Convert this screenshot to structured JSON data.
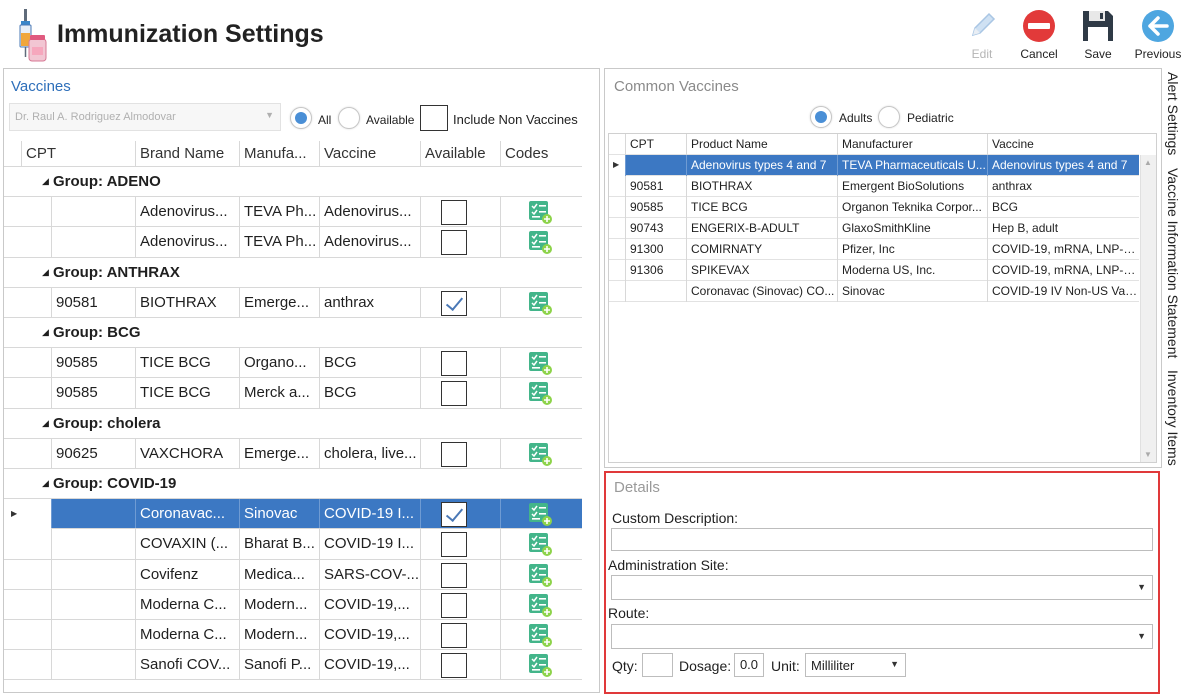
{
  "header": {
    "title": "Immunization Settings",
    "toolbar": {
      "edit": "Edit",
      "cancel": "Cancel",
      "save": "Save",
      "previous": "Previous"
    }
  },
  "vaccines": {
    "title": "Vaccines",
    "provider": "Dr. Raul A. Rodriguez Almodovar",
    "filter_all": "All",
    "filter_available": "Available",
    "include_non_vaccines": "Include Non Vaccines",
    "columns": [
      "CPT",
      "Brand Name",
      "Manufa...",
      "Vaccine",
      "Available",
      "Codes"
    ],
    "groups": [
      {
        "label": "Group: ADENO"
      },
      {
        "label": "Group: ANTHRAX"
      },
      {
        "label": "Group: BCG"
      },
      {
        "label": "Group: cholera"
      },
      {
        "label": "Group: COVID-19"
      }
    ],
    "rows": [
      {
        "cpt": "",
        "brand": "Adenovirus...",
        "manufacturer": "TEVA Ph...",
        "vaccine": "Adenovirus...",
        "available": false
      },
      {
        "cpt": "",
        "brand": "Adenovirus...",
        "manufacturer": "TEVA Ph...",
        "vaccine": "Adenovirus...",
        "available": false
      },
      {
        "cpt": "90581",
        "brand": "BIOTHRAX",
        "manufacturer": "Emerge...",
        "vaccine": "anthrax",
        "available": true
      },
      {
        "cpt": "90585",
        "brand": "TICE BCG",
        "manufacturer": "Organo...",
        "vaccine": "BCG",
        "available": false
      },
      {
        "cpt": "90585",
        "brand": "TICE BCG",
        "manufacturer": "Merck a...",
        "vaccine": "BCG",
        "available": false
      },
      {
        "cpt": "90625",
        "brand": "VAXCHORA",
        "manufacturer": "Emerge...",
        "vaccine": "cholera, live...",
        "available": false
      },
      {
        "cpt": "",
        "brand": "Coronavac...",
        "manufacturer": "Sinovac",
        "vaccine": "COVID-19 I...",
        "available": true
      },
      {
        "cpt": "",
        "brand": "COVAXIN (...",
        "manufacturer": "Bharat B...",
        "vaccine": "COVID-19 I...",
        "available": false
      },
      {
        "cpt": "",
        "brand": "Covifenz",
        "manufacturer": "Medica...",
        "vaccine": "SARS-COV-...",
        "available": false
      },
      {
        "cpt": "",
        "brand": "Moderna C...",
        "manufacturer": "Modern...",
        "vaccine": "COVID-19,...",
        "available": false
      },
      {
        "cpt": "",
        "brand": "Moderna C...",
        "manufacturer": "Modern...",
        "vaccine": "COVID-19,...",
        "available": false
      },
      {
        "cpt": "",
        "brand": "Sanofi COV...",
        "manufacturer": "Sanofi P...",
        "vaccine": "COVID-19,...",
        "available": false
      }
    ]
  },
  "common": {
    "title": "Common Vaccines",
    "adults": "Adults",
    "pediatric": "Pediatric",
    "columns": [
      "CPT",
      "Product Name",
      "Manufacturer",
      "Vaccine"
    ],
    "rows": [
      {
        "cpt": "",
        "product": "Adenovirus types 4 and 7",
        "manufacturer": "TEVA Pharmaceuticals U...",
        "vaccine": "Adenovirus types 4 and 7"
      },
      {
        "cpt": "90581",
        "product": "BIOTHRAX",
        "manufacturer": "Emergent BioSolutions",
        "vaccine": "anthrax"
      },
      {
        "cpt": "90585",
        "product": "TICE BCG",
        "manufacturer": "Organon Teknika Corpor...",
        "vaccine": "BCG"
      },
      {
        "cpt": "90743",
        "product": "ENGERIX-B-ADULT",
        "manufacturer": "GlaxoSmithKline",
        "vaccine": "Hep B, adult"
      },
      {
        "cpt": "91300",
        "product": "COMIRNATY",
        "manufacturer": "Pfizer, Inc",
        "vaccine": "COVID-19, mRNA, LNP-S,..."
      },
      {
        "cpt": "91306",
        "product": "SPIKEVAX",
        "manufacturer": "Moderna US, Inc.",
        "vaccine": "COVID-19, mRNA, LNP-S,..."
      },
      {
        "cpt": "",
        "product": "Coronavac (Sinovac) CO...",
        "manufacturer": "Sinovac",
        "vaccine": "COVID-19 IV Non-US Vac..."
      }
    ]
  },
  "details": {
    "title": "Details",
    "custom_description": "Custom Description:",
    "administration_site": "Administration Site:",
    "route": "Route:",
    "qty": "Qty:",
    "dosage": "Dosage:",
    "dosage_value": "0.0",
    "unit": "Unit:",
    "unit_value": "Milliliter"
  },
  "side_tabs": [
    "Alert Settings",
    "Vaccine Information Statement",
    "Inventory Items"
  ],
  "colors": {
    "selection": "#3c78c3",
    "accent": "#2e6fba",
    "highlight_border": "#e0393a"
  }
}
